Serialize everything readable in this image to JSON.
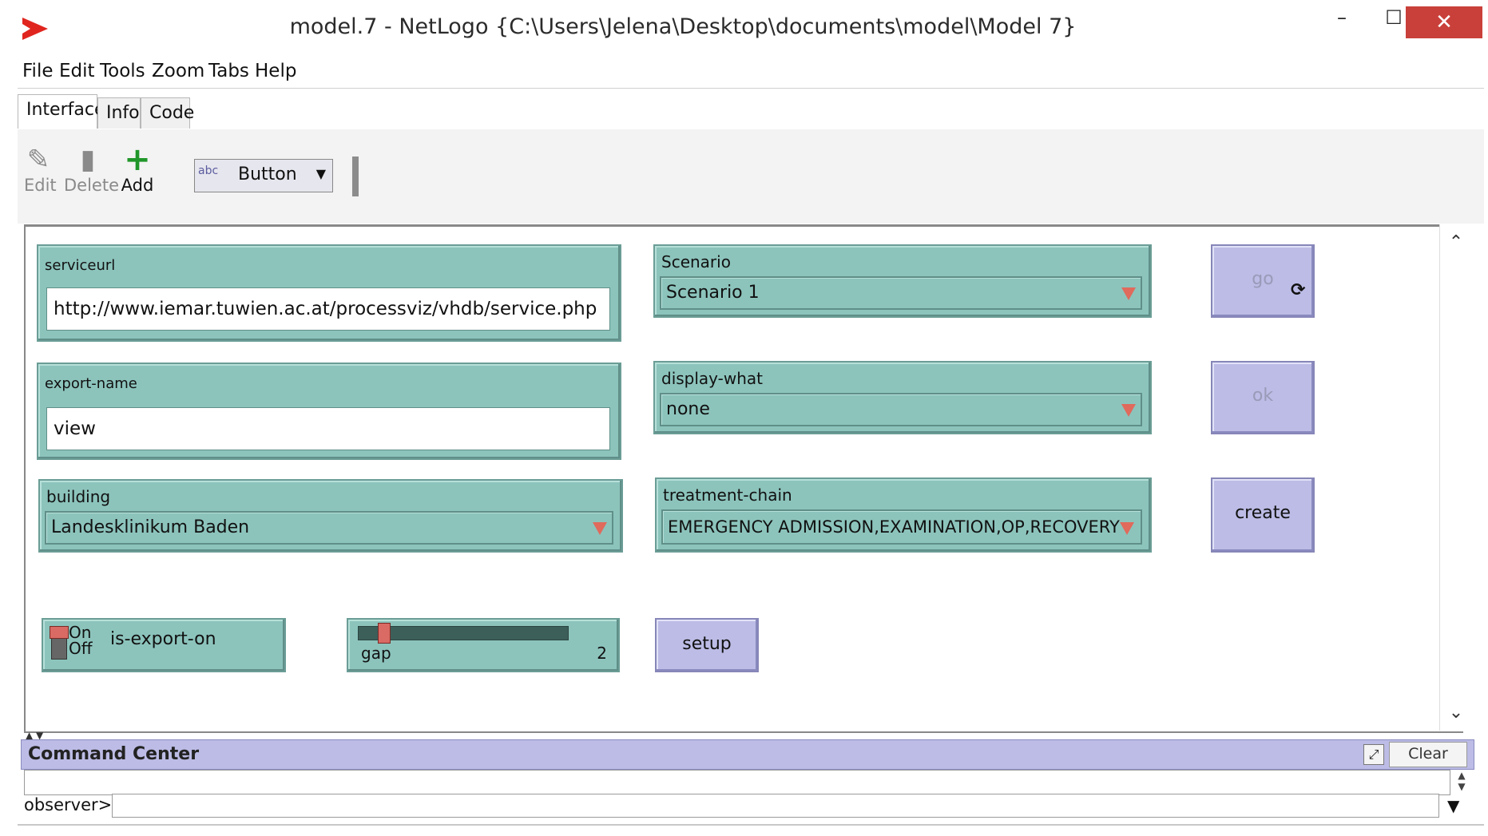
{
  "window": {
    "title": "model.7 - NetLogo {C:\\Users\\Jelena\\Desktop\\documents\\model\\Model 7}",
    "min_label": "–",
    "max_label": "☐",
    "close_label": "✕"
  },
  "menu": [
    "File",
    "Edit",
    "Tools",
    "Zoom",
    "Tabs",
    "Help"
  ],
  "tabs": [
    {
      "label": "Interface",
      "active": true
    },
    {
      "label": "Info",
      "active": false
    },
    {
      "label": "Code",
      "active": false
    }
  ],
  "toolbar": {
    "edit_label": "Edit",
    "delete_label": "Delete",
    "add_label": "Add",
    "widget_type": "Button",
    "widget_icon_text": "abc"
  },
  "widgets": {
    "serviceurl": {
      "label": "serviceurl",
      "value": "http://www.iemar.tuwien.ac.at/processviz/vhdb/service.php"
    },
    "export_name": {
      "label": "export-name",
      "value": "view"
    },
    "building": {
      "label": "building",
      "value": "Landesklinikum Baden"
    },
    "scenario": {
      "label": "Scenario",
      "value": "Scenario 1"
    },
    "display_what": {
      "label": "display-what",
      "value": "none"
    },
    "treatment_chain": {
      "label": "treatment-chain",
      "value": "EMERGENCY ADMISSION,EXAMINATION,OP,RECOVERY"
    },
    "go_button": {
      "label": "go",
      "forever_icon": "forever-icon"
    },
    "ok_button": {
      "label": "ok"
    },
    "create_button": {
      "label": "create"
    },
    "setup_button": {
      "label": "setup"
    },
    "export_switch": {
      "label": "is-export-on",
      "on_text": "On",
      "off_text": "Off",
      "state": "off"
    },
    "gap_slider": {
      "label": "gap",
      "value": "2",
      "fraction": 0.1
    }
  },
  "command_center": {
    "title": "Command Center",
    "clear_label": "Clear",
    "prompt": "observer>",
    "input_value": ""
  },
  "colors": {
    "widget_teal": "#8cc4bc",
    "button_lavender": "#bcbce6",
    "close_red": "#c9403a",
    "logo_red": "#e0251f",
    "add_green": "#20962a"
  }
}
